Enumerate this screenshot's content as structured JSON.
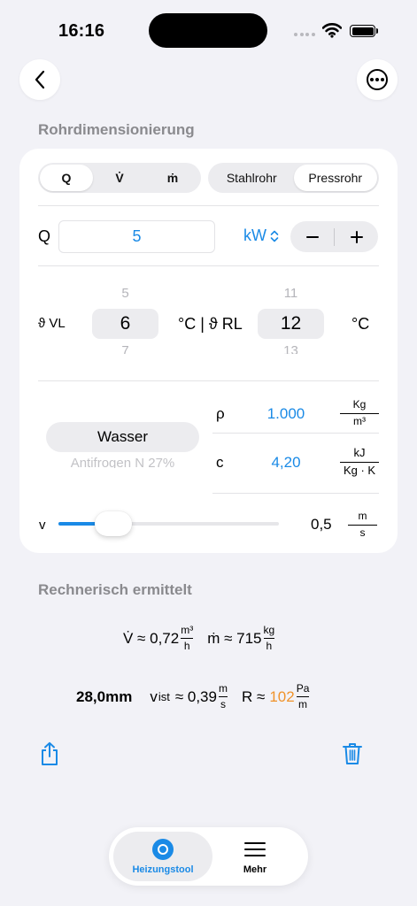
{
  "status": {
    "time": "16:16"
  },
  "header": {
    "section_title": "Rohrdimensionierung"
  },
  "flow_type": {
    "options": [
      "Q",
      "V̇",
      "ṁ"
    ],
    "selected": "Q"
  },
  "pipe_type": {
    "options": [
      "Stahlrohr",
      "Pressrohr"
    ],
    "selected": "Pressrohr"
  },
  "q_input": {
    "label": "Q",
    "value": "5",
    "unit": "kW",
    "minus": "−",
    "plus": "+"
  },
  "temperatures": {
    "vl_label": "ϑ VL",
    "vl_prev": "5",
    "vl_value": "6",
    "vl_next": "7",
    "separator": "°C | ϑ RL",
    "rl_prev": "11",
    "rl_value": "12",
    "rl_next": "13",
    "unit": "°C"
  },
  "fluid": {
    "selected": "Wasser",
    "next_option": "Antifrogen N 27%",
    "rho": {
      "label": "ρ",
      "value": "1.000",
      "unit_num": "Kg",
      "unit_den": "m³"
    },
    "c": {
      "label": "c",
      "value": "4,20",
      "unit_num": "kJ",
      "unit_den": "Kg · K"
    }
  },
  "velocity": {
    "label": "v",
    "value": "0,5",
    "unit_num": "m",
    "unit_den": "s",
    "slider_fraction": 0.25
  },
  "results": {
    "section_title": "Rechnerisch ermittelt",
    "vdot_prefix": "V̇ ≈ 0,72",
    "vdot_unit_num": "m³",
    "vdot_unit_den": "h",
    "mdot_prefix": "ṁ ≈ 715",
    "mdot_unit_num": "kg",
    "mdot_unit_den": "h",
    "diameter": "28,0mm",
    "vist_label": "v",
    "vist_sub": "ist",
    "vist_value": "≈ 0,39",
    "vist_unit_num": "m",
    "vist_unit_den": "s",
    "r_prefix": "R ≈",
    "r_value": "102",
    "r_unit_num": "Pa",
    "r_unit_den": "m"
  },
  "tabs": [
    {
      "label": "Heizungstool",
      "icon": "circle-icon",
      "active": true
    },
    {
      "label": "Mehr",
      "icon": "menu-icon",
      "active": false
    }
  ],
  "colors": {
    "accent": "#1a8ae6",
    "highlight": "#f0932b",
    "background": "#f2f2f7"
  }
}
